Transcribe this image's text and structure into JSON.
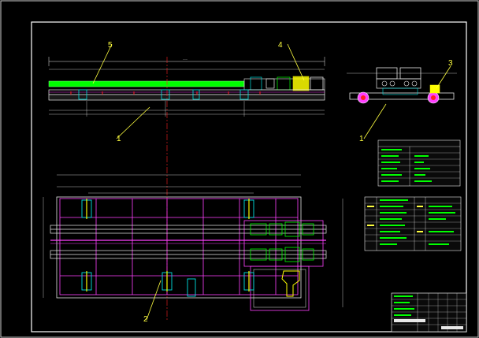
{
  "drawing": {
    "callouts": [
      "1",
      "2",
      "3",
      "4",
      "5",
      "1"
    ],
    "colors": {
      "background": "#000000",
      "frame": "#ffffff",
      "centerline": "#ff2020",
      "leader": "#ffff40",
      "magenta": "#ff40ff",
      "green": "#00ff00",
      "yellow": "#ffff00",
      "cyan": "#00e0e0",
      "white": "#e8e8e8"
    }
  }
}
